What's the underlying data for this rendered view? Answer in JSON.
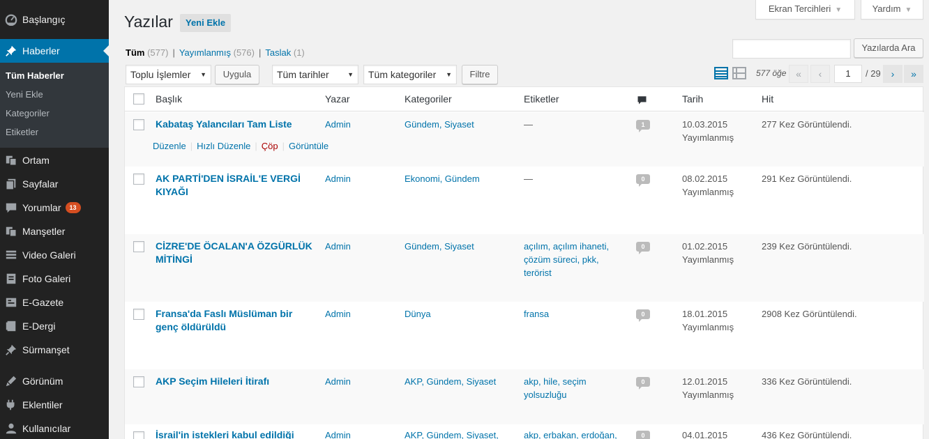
{
  "sidebar": {
    "items": [
      {
        "label": "Başlangıç",
        "icon": "dashboard-icon"
      },
      {
        "label": "Haberler",
        "icon": "pin-icon"
      },
      {
        "label": "Ortam",
        "icon": "media-icon"
      },
      {
        "label": "Sayfalar",
        "icon": "pages-icon"
      },
      {
        "label": "Yorumlar",
        "icon": "comments-icon",
        "badge": "13"
      },
      {
        "label": "Manşetler",
        "icon": "headlines-icon"
      },
      {
        "label": "Video Galeri",
        "icon": "video-icon"
      },
      {
        "label": "Foto Galeri",
        "icon": "photo-icon"
      },
      {
        "label": "E-Gazete",
        "icon": "newspaper-icon"
      },
      {
        "label": "E-Dergi",
        "icon": "magazine-icon"
      },
      {
        "label": "Sürmanşet",
        "icon": "pin-icon"
      },
      {
        "label": "Görünüm",
        "icon": "appearance-icon"
      },
      {
        "label": "Eklentiler",
        "icon": "plugins-icon"
      },
      {
        "label": "Kullanıcılar",
        "icon": "users-icon"
      }
    ],
    "submenu": [
      "Tüm Haberler",
      "Yeni Ekle",
      "Kategoriler",
      "Etiketler"
    ]
  },
  "header": {
    "title": "Yazılar",
    "add_new": "Yeni Ekle",
    "screen_options": "Ekran Tercihleri",
    "help": "Yardım"
  },
  "views": {
    "all": "Tüm",
    "all_count": "(577)",
    "published": "Yayımlanmış",
    "published_count": "(576)",
    "draft": "Taslak",
    "draft_count": "(1)",
    "sep": "|"
  },
  "search": {
    "button": "Yazılarda Ara",
    "value": ""
  },
  "filters": {
    "bulk": "Toplu İşlemler",
    "apply": "Uygula",
    "dates": "Tüm tarihler",
    "categories": "Tüm kategoriler",
    "filter": "Filtre"
  },
  "pagination": {
    "items": "577 öğe",
    "first": "«",
    "prev": "‹",
    "next": "›",
    "last": "»",
    "current": "1",
    "total": "/ 29"
  },
  "table": {
    "headers": {
      "title": "Başlık",
      "author": "Yazar",
      "categories": "Kategoriler",
      "tags": "Etiketler",
      "date": "Tarih",
      "hits": "Hit"
    },
    "row_actions": {
      "edit": "Düzenle",
      "quick_edit": "Hızlı Düzenle",
      "trash": "Çöp",
      "view": "Görüntüle",
      "sep": "|"
    },
    "rows": [
      {
        "title": "Kabataş Yalancıları Tam Liste",
        "title2": "",
        "author": "Admin",
        "categories": "Gündem, Siyaset",
        "tags1": "—",
        "tags2": "",
        "tags3": "",
        "comments": "1",
        "date": "10.03.2015",
        "status": "Yayımlanmış",
        "hits": "277 Kez Görüntülendi."
      },
      {
        "title": "AK PARTİ'DEN İSRAİL'E VERGİ",
        "title2": "KIYAĞI",
        "author": "Admin",
        "categories": "Ekonomi, Gündem",
        "tags1": "—",
        "tags2": "",
        "tags3": "",
        "comments": "0",
        "date": "08.02.2015",
        "status": "Yayımlanmış",
        "hits": "291 Kez Görüntülendi."
      },
      {
        "title": "CİZRE'DE ÖCALAN'A ÖZGÜRLÜK",
        "title2": "MİTİNGİ",
        "author": "Admin",
        "categories": "Gündem, Siyaset",
        "tags1": "açılım, açılım ihaneti,",
        "tags2": "çözüm süreci, pkk,",
        "tags3": "terörist",
        "comments": "0",
        "date": "01.02.2015",
        "status": "Yayımlanmış",
        "hits": "239 Kez Görüntülendi."
      },
      {
        "title": "Fransa'da Faslı Müslüman bir",
        "title2": "genç öldürüldü",
        "author": "Admin",
        "categories": "Dünya",
        "tags1": "fransa",
        "tags2": "",
        "tags3": "",
        "comments": "0",
        "date": "18.01.2015",
        "status": "Yayımlanmış",
        "hits": "2908 Kez Görüntülendi."
      },
      {
        "title": "AKP Seçim Hileleri İtirafı",
        "title2": "",
        "author": "Admin",
        "categories": "AKP, Gündem, Siyaset",
        "tags1": "akp, hile, seçim",
        "tags2": "yolsuzluğu",
        "tags3": "",
        "comments": "0",
        "date": "12.01.2015",
        "status": "Yayımlanmış",
        "hits": "336 Kez Görüntülendi."
      },
      {
        "title": "İsrail'in istekleri kabul edildiği",
        "title2": "",
        "author": "Admin",
        "categories": "AKP, Gündem, Siyaset,",
        "tags1": "akp, erbakan, erdoğan,",
        "tags2": "",
        "tags3": "",
        "comments": "0",
        "date": "04.01.2015",
        "status": "",
        "hits": "436 Kez Görüntülendi."
      }
    ]
  }
}
